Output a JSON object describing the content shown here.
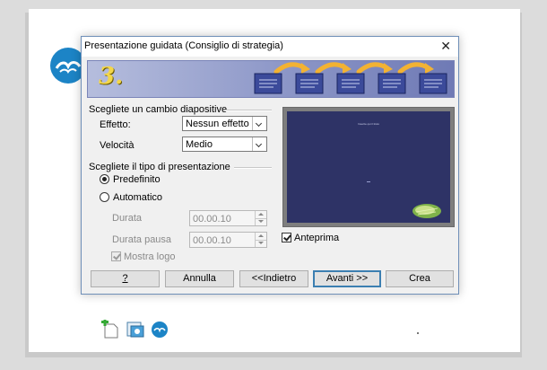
{
  "dialog": {
    "title": "Presentazione guidata (Consiglio di strategia)",
    "close_glyph": "✕",
    "step_number": "3."
  },
  "transition": {
    "section_title": "Scegliete un cambio diapositive",
    "effect": {
      "label": "Effetto:",
      "value": "Nessun effetto"
    },
    "speed": {
      "label": "Velocità",
      "value": "Medio"
    }
  },
  "presentation_type": {
    "section_title": "Scegliete il tipo di presentazione",
    "options": [
      {
        "label": "Predefinito",
        "selected": true
      },
      {
        "label": "Automatico",
        "selected": false
      }
    ],
    "duration": {
      "label": "Durata",
      "value": "00.00.10"
    },
    "pause_duration": {
      "label": "Durata pausa",
      "value": "00.00.10"
    },
    "show_logo": {
      "label": "Mostra logo",
      "checked": true,
      "enabled": false
    }
  },
  "preview": {
    "label": "Anteprima",
    "checked": true,
    "slide_title": "Inserite qui il titolo"
  },
  "buttons": {
    "help": "?",
    "cancel": "Annulla",
    "back": "<<Indietro",
    "next": "Avanti >>",
    "create": "Crea"
  },
  "colors": {
    "banner_start": "#b5bddd",
    "banner_end": "#6f7ab5",
    "slide_bg": "#2e3366",
    "arrow": "#f2b233",
    "default_button_border": "#3c7fb1"
  }
}
